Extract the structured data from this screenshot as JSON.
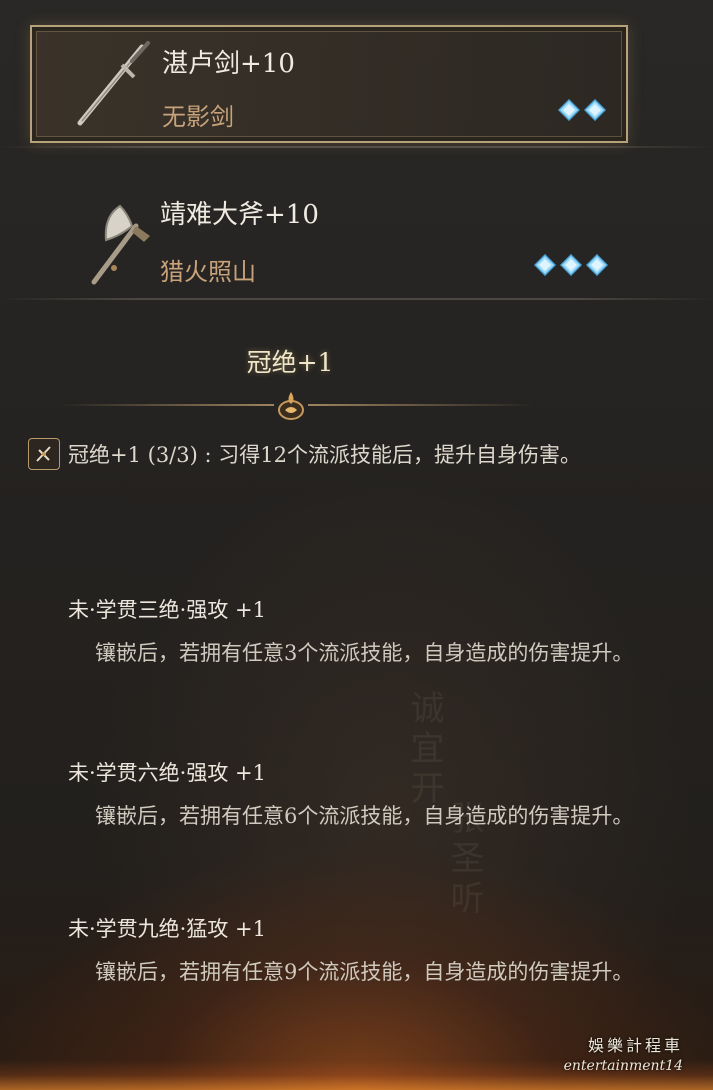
{
  "weapons": [
    {
      "name": "湛卢剑+10",
      "skill": "无影剑",
      "gems": 2,
      "selected": true,
      "icon": "sword-icon"
    },
    {
      "name": "靖难大斧+10",
      "skill": "猎火照山",
      "gems": 3,
      "selected": false,
      "icon": "axe-icon"
    }
  ],
  "set": {
    "title": "冠绝+1",
    "effect": "冠绝+1 (3/3) : 习得12个流派技能后，提升自身伤害。",
    "icon": "crossed-blades-icon"
  },
  "perks": [
    {
      "name": "未·学贯三绝·强攻 +1",
      "desc": "镶嵌后，若拥有任意3个流派技能，自身造成的伤害提升。"
    },
    {
      "name": "未·学贯六绝·强攻 +1",
      "desc": "镶嵌后，若拥有任意6个流派技能，自身造成的伤害提升。"
    },
    {
      "name": "未·学贯九绝·猛攻 +1",
      "desc": "镶嵌后，若拥有任意9个流派技能，自身造成的伤害提升。"
    }
  ],
  "watermark": {
    "line1": "娛樂計程車",
    "line2": "entertainment14"
  },
  "colors": {
    "gem": "#7ec8f0",
    "accent_gold": "#b7a17a",
    "skill_text": "#c8a27a"
  }
}
